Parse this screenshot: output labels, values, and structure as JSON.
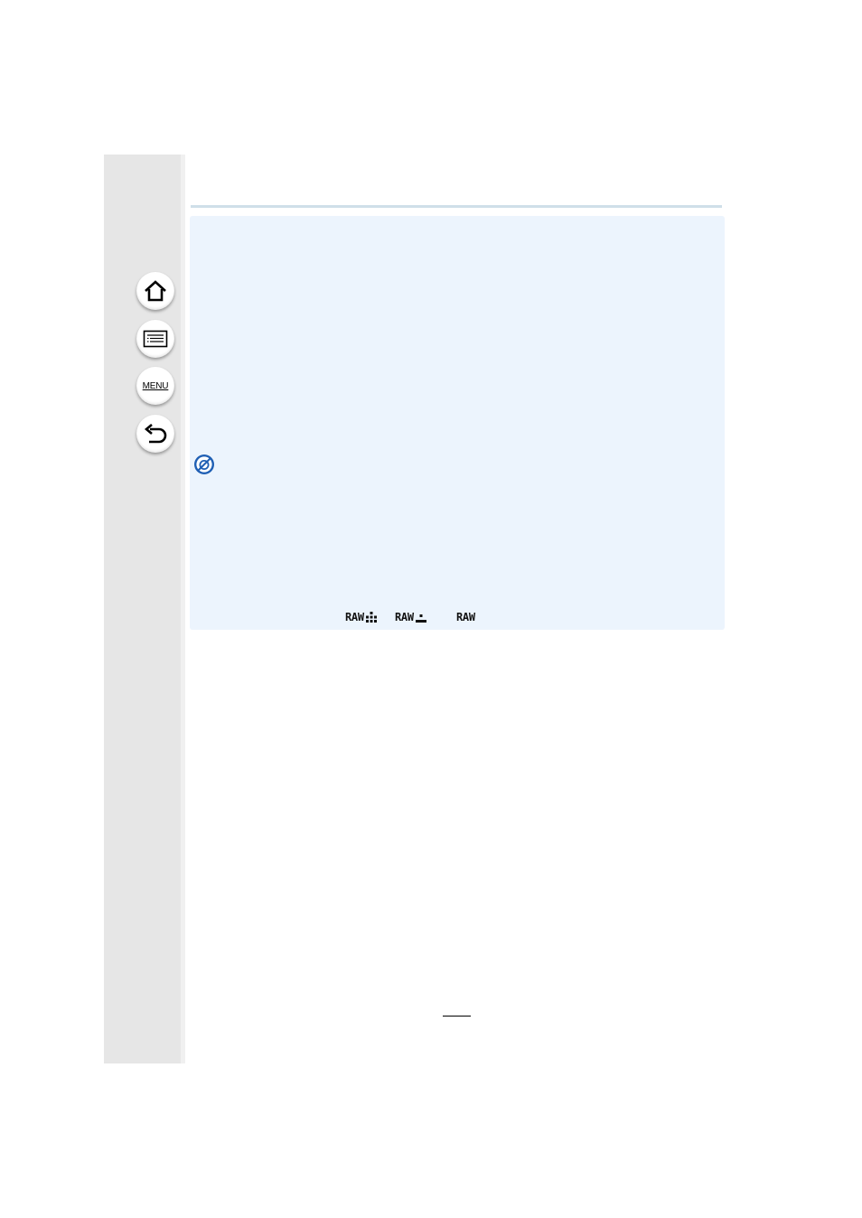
{
  "sidebar": {
    "buttons": [
      {
        "id": "home",
        "icon": "home-icon"
      },
      {
        "id": "contents",
        "icon": "list-icon"
      },
      {
        "id": "menu",
        "label": "MENU"
      },
      {
        "id": "back",
        "icon": "back-arrow-icon"
      }
    ]
  },
  "notice": {
    "icon": "not-available-icon",
    "icon_color": "#1f5fb4"
  },
  "quality_icons": {
    "fine": "RAW",
    "standard": "RAW",
    "raw_only": "RAW"
  },
  "page": {
    "number": ""
  },
  "colors": {
    "sidebar": "#e6e6e6",
    "panel": "#ecf4fd",
    "rule": "#cfdfe9"
  }
}
